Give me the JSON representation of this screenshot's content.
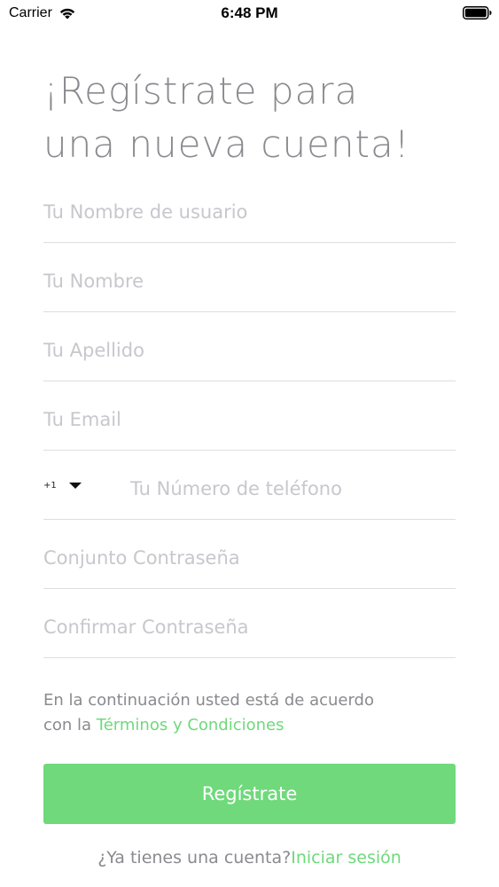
{
  "status_bar": {
    "carrier": "Carrier",
    "time": "6:48 PM",
    "wifi_icon": "wifi-icon",
    "battery_icon": "battery-icon"
  },
  "title": {
    "line1": "¡Regístrate para",
    "line2": "una nueva cuenta!"
  },
  "form": {
    "username_placeholder": "Tu Nombre de usuario",
    "firstname_placeholder": "Tu Nombre",
    "lastname_placeholder": "Tu Apellido",
    "email_placeholder": "Tu Email",
    "phone": {
      "country_code": "+1",
      "dropdown_icon": "chevron-down-icon",
      "placeholder": "Tu Número de teléfono"
    },
    "password_placeholder": "Conjunto Contraseña",
    "confirm_password_placeholder": "Confirmar Contraseña"
  },
  "terms": {
    "text_line1": "En la continuación usted está de acuerdo",
    "text_prefix": "con la ",
    "link_label": "Términos y Condiciones"
  },
  "register_button": {
    "label": "Regístrate"
  },
  "footer": {
    "question": "¿Ya tienes una cuenta?",
    "login_link": "Iniciar sesión"
  },
  "colors": {
    "accent": "#6fd97b",
    "text": "#8a8a8f",
    "placeholder": "#c7c7cd",
    "divider": "#dedede"
  }
}
